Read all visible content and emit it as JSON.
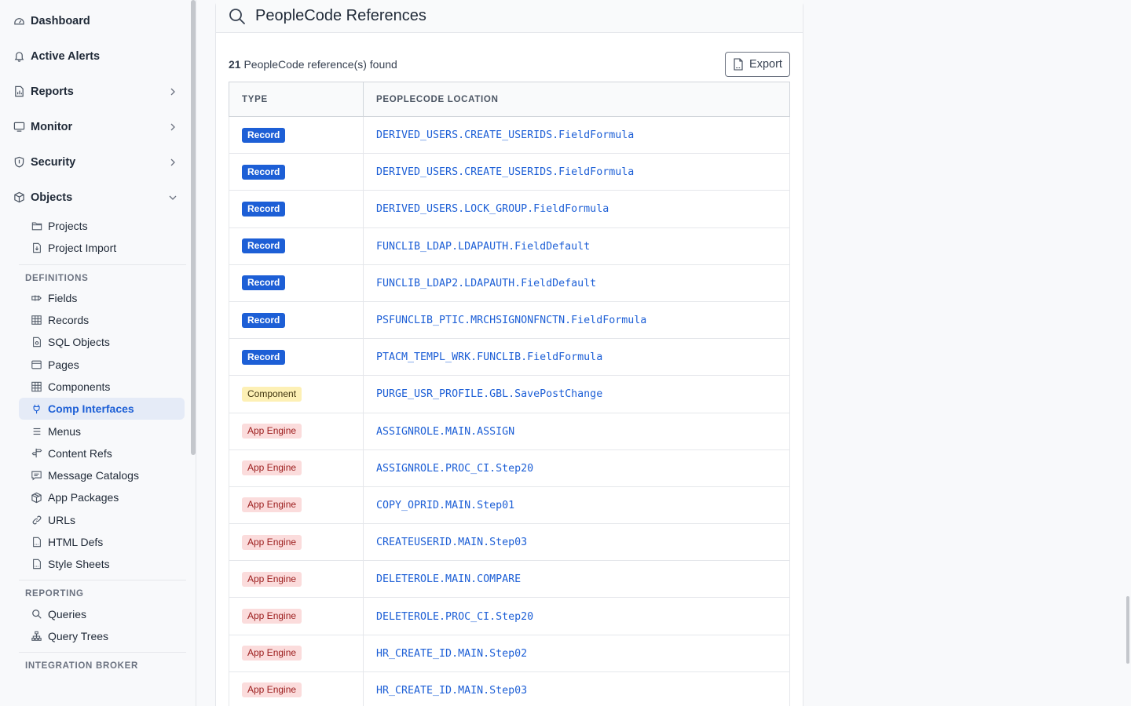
{
  "sidebar": {
    "top_items": [
      {
        "label": "Dashboard",
        "icon": "dashboard-icon",
        "chevron": ""
      },
      {
        "label": "Active Alerts",
        "icon": "bell-icon",
        "chevron": ""
      },
      {
        "label": "Reports",
        "icon": "report-icon",
        "chevron": "right"
      },
      {
        "label": "Monitor",
        "icon": "monitor-icon",
        "chevron": "right"
      },
      {
        "label": "Security",
        "icon": "shield-icon",
        "chevron": "right"
      },
      {
        "label": "Objects",
        "icon": "cube-icon",
        "chevron": "down"
      }
    ],
    "objects_items": [
      {
        "label": "Projects",
        "icon": "folder-icon"
      },
      {
        "label": "Project Import",
        "icon": "file-import-icon"
      }
    ],
    "definitions_label": "DEFINITIONS",
    "definitions_items": [
      {
        "label": "Fields",
        "icon": "field-icon"
      },
      {
        "label": "Records",
        "icon": "table-icon"
      },
      {
        "label": "SQL Objects",
        "icon": "sql-file-icon"
      },
      {
        "label": "Pages",
        "icon": "page-icon"
      },
      {
        "label": "Components",
        "icon": "grid-icon"
      },
      {
        "label": "Comp Interfaces",
        "icon": "plug-icon",
        "active": true
      },
      {
        "label": "Menus",
        "icon": "menu-icon"
      },
      {
        "label": "Content Refs",
        "icon": "signpost-icon"
      },
      {
        "label": "Message Catalogs",
        "icon": "message-icon"
      },
      {
        "label": "App Packages",
        "icon": "package-icon"
      },
      {
        "label": "URLs",
        "icon": "link-icon"
      },
      {
        "label": "HTML Defs",
        "icon": "html-file-icon"
      },
      {
        "label": "Style Sheets",
        "icon": "css-file-icon"
      }
    ],
    "reporting_label": "REPORTING",
    "reporting_items": [
      {
        "label": "Queries",
        "icon": "search-icon"
      },
      {
        "label": "Query Trees",
        "icon": "tree-icon"
      }
    ],
    "integration_label": "INTEGRATION BROKER"
  },
  "panel": {
    "title": "PeopleCode References",
    "count": "21",
    "count_suffix": " PeopleCode reference(s) found",
    "export_label": "Export",
    "columns": [
      "TYPE",
      "PEOPLECODE LOCATION"
    ],
    "rows": [
      {
        "type": "Record",
        "kind": "record",
        "location": "DERIVED_USERS.CREATE_USERIDS.FieldFormula"
      },
      {
        "type": "Record",
        "kind": "record",
        "location": "DERIVED_USERS.CREATE_USERIDS.FieldFormula"
      },
      {
        "type": "Record",
        "kind": "record",
        "location": "DERIVED_USERS.LOCK_GROUP.FieldFormula"
      },
      {
        "type": "Record",
        "kind": "record",
        "location": "FUNCLIB_LDAP.LDAPAUTH.FieldDefault"
      },
      {
        "type": "Record",
        "kind": "record",
        "location": "FUNCLIB_LDAP2.LDAPAUTH.FieldDefault"
      },
      {
        "type": "Record",
        "kind": "record",
        "location": "PSFUNCLIB_PTIC.MRCHSIGNONFNCTN.FieldFormula"
      },
      {
        "type": "Record",
        "kind": "record",
        "location": "PTACM_TEMPL_WRK.FUNCLIB.FieldFormula"
      },
      {
        "type": "Component",
        "kind": "component",
        "location": "PURGE_USR_PROFILE.GBL.SavePostChange"
      },
      {
        "type": "App Engine",
        "kind": "appengine",
        "location": "ASSIGNROLE.MAIN.ASSIGN"
      },
      {
        "type": "App Engine",
        "kind": "appengine",
        "location": "ASSIGNROLE.PROC_CI.Step20"
      },
      {
        "type": "App Engine",
        "kind": "appengine",
        "location": "COPY_OPRID.MAIN.Step01"
      },
      {
        "type": "App Engine",
        "kind": "appengine",
        "location": "CREATEUSERID.MAIN.Step03"
      },
      {
        "type": "App Engine",
        "kind": "appengine",
        "location": "DELETEROLE.MAIN.COMPARE"
      },
      {
        "type": "App Engine",
        "kind": "appengine",
        "location": "DELETEROLE.PROC_CI.Step20"
      },
      {
        "type": "App Engine",
        "kind": "appengine",
        "location": "HR_CREATE_ID.MAIN.Step02"
      },
      {
        "type": "App Engine",
        "kind": "appengine",
        "location": "HR_CREATE_ID.MAIN.Step03"
      }
    ]
  },
  "colors": {
    "accent": "#1d5fd6",
    "record_badge": "#1d5fd6",
    "component_badge": "#fdf0b5",
    "appengine_badge": "#fbdcdc",
    "active_nav_bg": "#e5ebf7"
  }
}
